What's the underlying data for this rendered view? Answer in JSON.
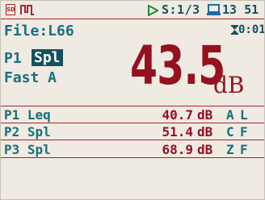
{
  "status": {
    "sd_icon_text": "SD",
    "measurement_counter": "S:1/3",
    "clock": "13 51"
  },
  "file": {
    "label": "File:L66"
  },
  "elapsed": "0:01",
  "main": {
    "channel": "P1",
    "function": "Spl",
    "mode": "Fast A",
    "value": "43.5",
    "unit": "dB"
  },
  "rows": [
    {
      "name": "P1 Leq",
      "value": "40.7",
      "unit": "dB",
      "weighting": "A",
      "time_weighting": "L"
    },
    {
      "name": "P2 Spl",
      "value": "51.4",
      "unit": "dB",
      "weighting": "C",
      "time_weighting": "F"
    },
    {
      "name": "P3 Spl",
      "value": "68.9",
      "unit": "dB",
      "weighting": "Z",
      "time_weighting": "F"
    }
  ],
  "colors": {
    "accent_red": "#961020",
    "text_teal": "#17707a",
    "highlight_bg": "#14515e",
    "background": "#efeae2"
  },
  "icons": [
    "sd-card-icon",
    "pulse-icon",
    "play-icon",
    "pc-link-icon",
    "hourglass-icon"
  ]
}
